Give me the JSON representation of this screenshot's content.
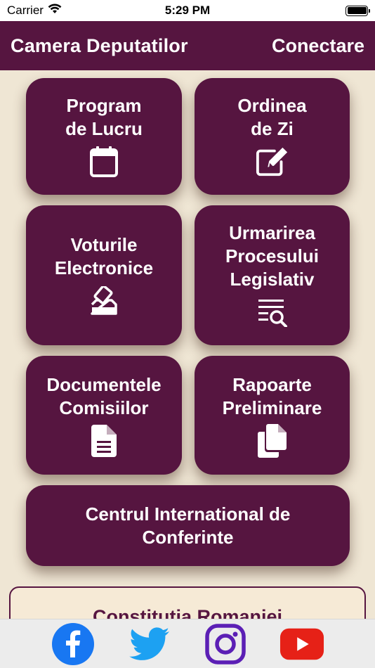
{
  "status_bar": {
    "carrier": "Carrier",
    "time": "5:29 PM",
    "wifi_icon": "wifi-icon",
    "battery_icon": "battery-icon"
  },
  "nav_bar": {
    "title": "Camera Deputatilor",
    "action": "Conectare",
    "background": "#561540"
  },
  "tiles": [
    {
      "label": "Program\nde Lucru",
      "icon": "calendar-icon"
    },
    {
      "label": "Ordinea\nde Zi",
      "icon": "edit-icon"
    },
    {
      "label": "Voturile\nElectronice",
      "icon": "vote-ballot-icon"
    },
    {
      "label": "Urmarirea\nProcesului\nLegislativ",
      "icon": "list-search-icon"
    },
    {
      "label": "Documentele\nComisiilor",
      "icon": "document-icon"
    },
    {
      "label": "Rapoarte\nPreliminare",
      "icon": "copy-documents-icon"
    },
    {
      "label": "Centrul International de\nConferinte",
      "icon": ""
    }
  ],
  "constitution": {
    "label": "Constitutia Romaniei"
  },
  "social": [
    {
      "name": "facebook",
      "icon": "facebook-icon",
      "color": "#1877f2"
    },
    {
      "name": "twitter",
      "icon": "twitter-icon",
      "color": "#1da1f2"
    },
    {
      "name": "instagram",
      "icon": "instagram-icon",
      "color": "#5b1fb5"
    },
    {
      "name": "youtube",
      "icon": "youtube-icon",
      "color": "#e62117"
    }
  ],
  "colors": {
    "brand": "#561540",
    "background": "#efe6d4"
  }
}
